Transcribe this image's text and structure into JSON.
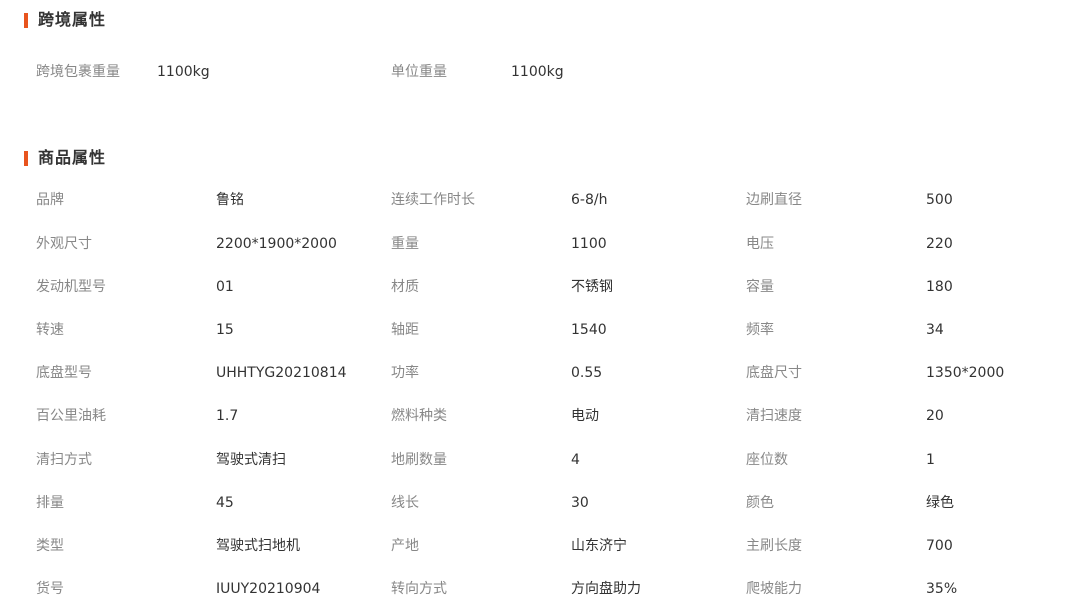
{
  "cross_border": {
    "title": "跨境属性",
    "items": [
      {
        "label": "跨境包裹重量",
        "value": "1100kg"
      },
      {
        "label": "单位重量",
        "value": "1100kg"
      }
    ]
  },
  "product": {
    "title": "商品属性",
    "rows": [
      [
        {
          "label": "品牌",
          "value": "鲁铭"
        },
        {
          "label": "连续工作时长",
          "value": "6-8/h"
        },
        {
          "label": "边刷直径",
          "value": "500"
        }
      ],
      [
        {
          "label": "外观尺寸",
          "value": "2200*1900*2000"
        },
        {
          "label": "重量",
          "value": "1100"
        },
        {
          "label": "电压",
          "value": "220"
        }
      ],
      [
        {
          "label": "发动机型号",
          "value": "01"
        },
        {
          "label": "材质",
          "value": "不锈钢"
        },
        {
          "label": "容量",
          "value": "180"
        }
      ],
      [
        {
          "label": "转速",
          "value": "15"
        },
        {
          "label": "轴距",
          "value": "1540"
        },
        {
          "label": "频率",
          "value": "34"
        }
      ],
      [
        {
          "label": "底盘型号",
          "value": "UHHTYG20210814"
        },
        {
          "label": "功率",
          "value": "0.55"
        },
        {
          "label": "底盘尺寸",
          "value": "1350*2000"
        }
      ],
      [
        {
          "label": "百公里油耗",
          "value": "1.7"
        },
        {
          "label": "燃料种类",
          "value": "电动"
        },
        {
          "label": "清扫速度",
          "value": "20"
        }
      ],
      [
        {
          "label": "清扫方式",
          "value": "驾驶式清扫"
        },
        {
          "label": "地刷数量",
          "value": "4"
        },
        {
          "label": "座位数",
          "value": "1"
        }
      ],
      [
        {
          "label": "排量",
          "value": "45"
        },
        {
          "label": "线长",
          "value": "30"
        },
        {
          "label": "颜色",
          "value": "绿色"
        }
      ],
      [
        {
          "label": "类型",
          "value": "驾驶式扫地机"
        },
        {
          "label": "产地",
          "value": "山东济宁"
        },
        {
          "label": "主刷长度",
          "value": "700"
        }
      ],
      [
        {
          "label": "货号",
          "value": "IUUY20210904"
        },
        {
          "label": "转向方式",
          "value": "方向盘助力"
        },
        {
          "label": "爬坡能力",
          "value": "35%"
        }
      ]
    ]
  }
}
